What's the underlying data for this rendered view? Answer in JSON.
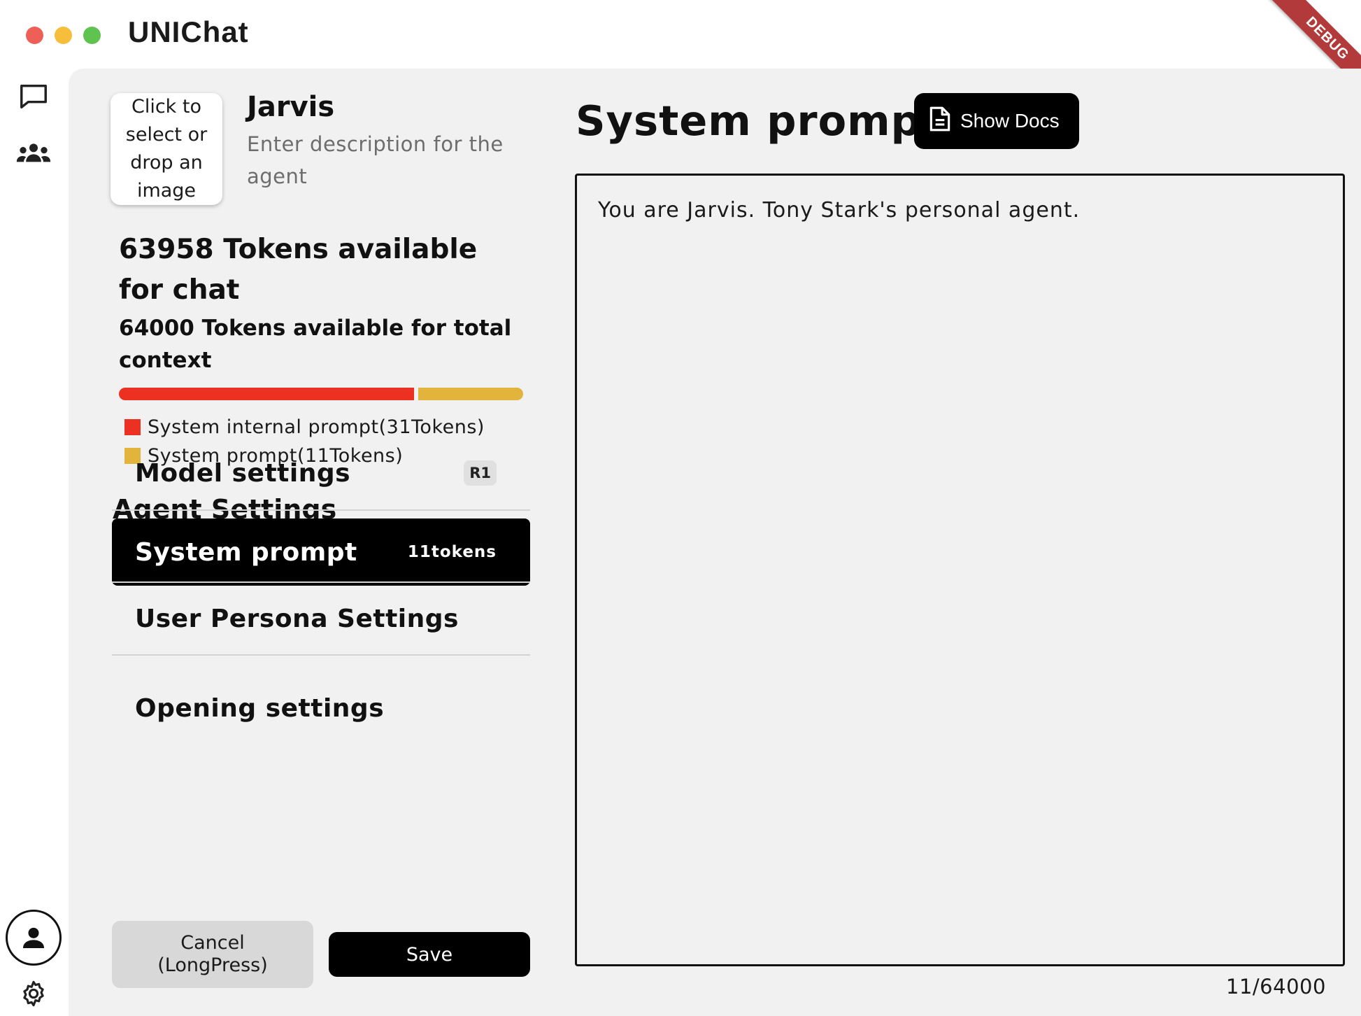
{
  "app": {
    "title": "UNIChat",
    "debug_label": "DEBUG"
  },
  "rail": {
    "icons": [
      "chat-bubble-icon",
      "group-icon",
      "user-avatar-icon",
      "gear-icon"
    ]
  },
  "agent": {
    "image_placeholder": "Click to select or drop an image",
    "name": "Jarvis",
    "description_placeholder": "Enter description for the agent"
  },
  "tokens": {
    "chat_available": "63958 Tokens available for chat",
    "total_available": "64000 Tokens available for total context",
    "bar": {
      "internal_fraction": 0.738,
      "prompt_fraction": 0.262
    },
    "legend": [
      {
        "label": "System internal prompt(31Tokens)",
        "color": "#ec3123"
      },
      {
        "label": "System prompt(11Tokens)",
        "color": "#e2b43c"
      }
    ]
  },
  "settings": {
    "title": "Agent Settings",
    "items": [
      {
        "label": "Model settings",
        "badge": "R1"
      },
      {
        "label": "System prompt",
        "badge": "11tokens",
        "active": true
      },
      {
        "label": "User Persona Settings"
      },
      {
        "label": "Opening settings"
      }
    ]
  },
  "actions": {
    "cancel_label": "Cancel\n(LongPress)",
    "save_label": "Save"
  },
  "editor": {
    "title": "System prompt",
    "docs_button": "Show Docs",
    "prompt_text": "You are Jarvis. Tony Stark's personal agent.",
    "counter": "11/64000"
  },
  "colors": {
    "accent": "#000000",
    "panel_bg": "#f1f1f1",
    "internal_prompt": "#ec3123",
    "system_prompt": "#e2b43c"
  }
}
